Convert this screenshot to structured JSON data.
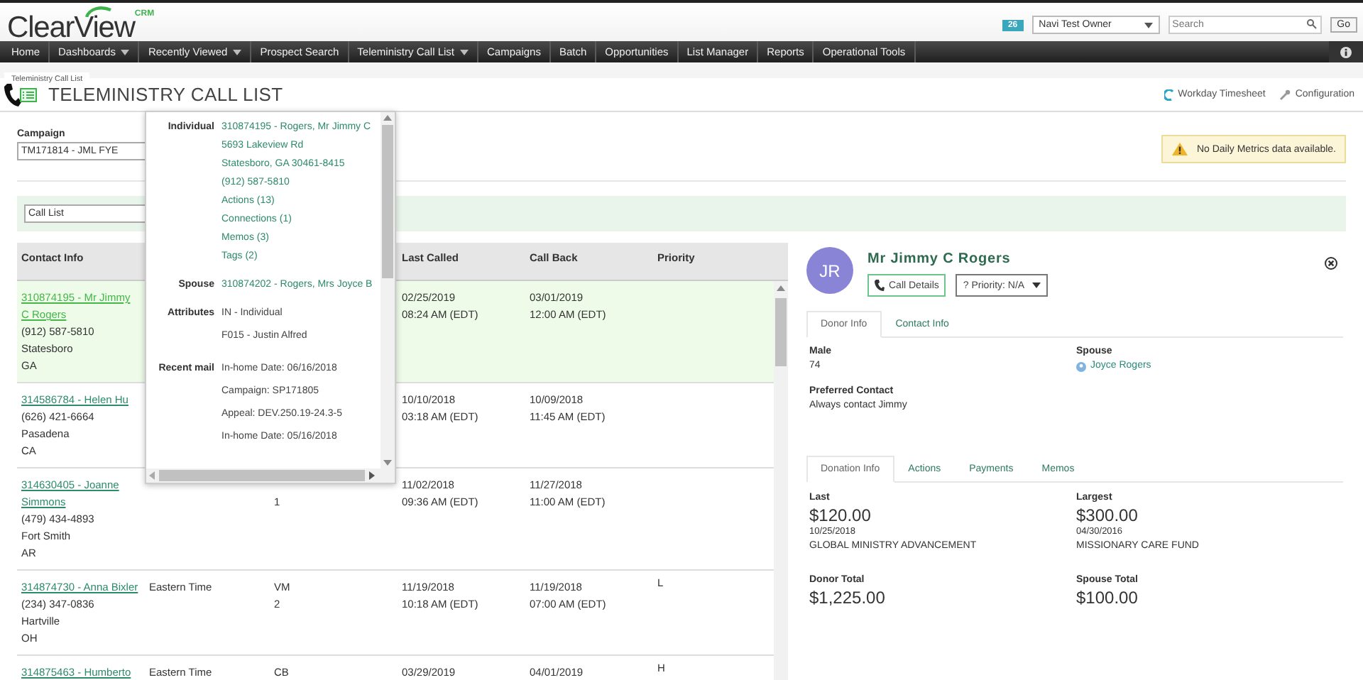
{
  "header": {
    "logo": "ClearView",
    "logo_tag": "CRM",
    "badge": "26",
    "user": "Navi Test Owner",
    "search": {
      "placeholder": "Search"
    },
    "go": "Go"
  },
  "nav": [
    {
      "label": "Home",
      "dropdown": false
    },
    {
      "label": "Dashboards",
      "dropdown": true
    },
    {
      "label": "Recently Viewed",
      "dropdown": true
    },
    {
      "label": "Prospect Search",
      "dropdown": false
    },
    {
      "label": "Teleministry Call List",
      "dropdown": true
    },
    {
      "label": "Campaigns",
      "dropdown": false
    },
    {
      "label": "Batch",
      "dropdown": false
    },
    {
      "label": "Opportunities",
      "dropdown": false
    },
    {
      "label": "List Manager",
      "dropdown": false
    },
    {
      "label": "Reports",
      "dropdown": false
    },
    {
      "label": "Operational Tools",
      "dropdown": false
    }
  ],
  "breadcrumb": "Teleministry Call List",
  "title": "TELEMINISTRY CALL LIST",
  "page_links": [
    {
      "kind": "timesheet",
      "label": "Workday Timesheet"
    },
    {
      "kind": "configuration",
      "label": "Configuration"
    }
  ],
  "campaign": {
    "label": "Campaign",
    "value": "TM171814 - JML FYE"
  },
  "alert": "No Daily Metrics data available.",
  "list_filter": {
    "value": "Call List"
  },
  "table": {
    "columns": {
      "contact_info": "Contact Info",
      "last_called": "Last Called",
      "call_back": "Call Back",
      "priority": "Priority"
    },
    "rows": [
      {
        "selected": true,
        "contact": "310874195 - Mr Jimmy C Rogers",
        "phone": "(912) 587-5810",
        "city": "Statesboro",
        "state": "GA",
        "last_called": [
          "02/25/2019",
          "08:24 AM (EDT)"
        ],
        "call_back": [
          "03/01/2019",
          "12:00 AM (EDT)"
        ]
      },
      {
        "selected": false,
        "contact": "314586784 - Helen Hu",
        "phone": "(626) 421-6664",
        "city": "Pasadena",
        "state": "CA",
        "last_called": [
          "10/10/2018",
          "03:18 AM (EDT)"
        ],
        "call_back": [
          "10/09/2018",
          "11:45 AM (EDT)"
        ]
      },
      {
        "selected": false,
        "contact": "314630405 - Joanne Simmons",
        "phone": "(479) 434-4893",
        "city": "Fort Smith",
        "state": "AR",
        "attempts": "1",
        "last_called": [
          "11/02/2018",
          "09:36 AM (EDT)"
        ],
        "call_back": [
          "11/27/2018",
          "11:00 AM (EDT)"
        ]
      },
      {
        "selected": false,
        "contact": "314874730 - Anna Bixler",
        "phone": "(234) 347-0836",
        "city": "Hartville",
        "state": "OH",
        "time_zone": "Eastern Time",
        "disposition": "VM",
        "attempts": "2",
        "last_called": [
          "11/19/2018",
          "10:18 AM (EDT)"
        ],
        "call_back": [
          "11/19/2018",
          "07:00 AM (EDT)"
        ],
        "priority": "L"
      },
      {
        "selected": false,
        "contact": "314875463 - Humberto",
        "time_zone": "Eastern Time",
        "disposition": "CB",
        "last_called": [
          "03/29/2019"
        ],
        "call_back": [
          "04/01/2019"
        ],
        "priority": "H"
      }
    ]
  },
  "hover_card": {
    "sections": [
      {
        "label": "Individual",
        "link": true,
        "lines": [
          "310874195 - Rogers, Mr Jimmy C",
          "5693 Lakeview Rd",
          "Statesboro, GA 30461-8415",
          "(912) 587-5810",
          "Actions (13)",
          "Connections (1)",
          "Memos (3)",
          "Tags (2)"
        ]
      },
      {
        "label": "Spouse",
        "link": true,
        "lines": [
          "310874202 - Rogers, Mrs Joyce B"
        ]
      },
      {
        "label": "Attributes",
        "link": false,
        "lines": [
          "IN - Individual",
          "F015 - Justin Alfred"
        ]
      },
      {
        "label": "Recent mail",
        "link": false,
        "lines": [
          "In-home Date: 06/16/2018",
          "Campaign: SP171805",
          "Appeal: DEV.250.19-24.3-5",
          "In-home Date: 05/16/2018"
        ]
      }
    ]
  },
  "detail": {
    "initials": "JR",
    "name": "Mr Jimmy C Rogers",
    "call_button": "Call Details",
    "priority_button": "? Priority: N/A",
    "donor_tabs": [
      {
        "label": "Donor Info",
        "selected": true
      },
      {
        "label": "Contact Info",
        "selected": false
      }
    ],
    "fields": [
      {
        "label": "Male",
        "value": "74",
        "link": false
      },
      {
        "label": "Spouse",
        "value": "Joyce Rogers",
        "link": true
      },
      {
        "label": "Preferred Contact",
        "value": "Always contact Jimmy",
        "link": false
      }
    ],
    "donation_tabs": [
      {
        "label": "Donation Info",
        "selected": true
      },
      {
        "label": "Actions",
        "selected": false
      },
      {
        "label": "Payments",
        "selected": false
      },
      {
        "label": "Memos",
        "selected": false
      }
    ],
    "stats": [
      {
        "label": "Last",
        "amount": "$120.00",
        "date": "10/25/2018",
        "fund": "GLOBAL MINISTRY ADVANCEMENT"
      },
      {
        "label": "Largest",
        "amount": "$300.00",
        "date": "04/30/2016",
        "fund": "MISSIONARY CARE FUND"
      },
      {
        "label": "Donor Total",
        "amount": "$1,225.00"
      },
      {
        "label": "Spouse Total",
        "amount": "$100.00"
      }
    ]
  }
}
